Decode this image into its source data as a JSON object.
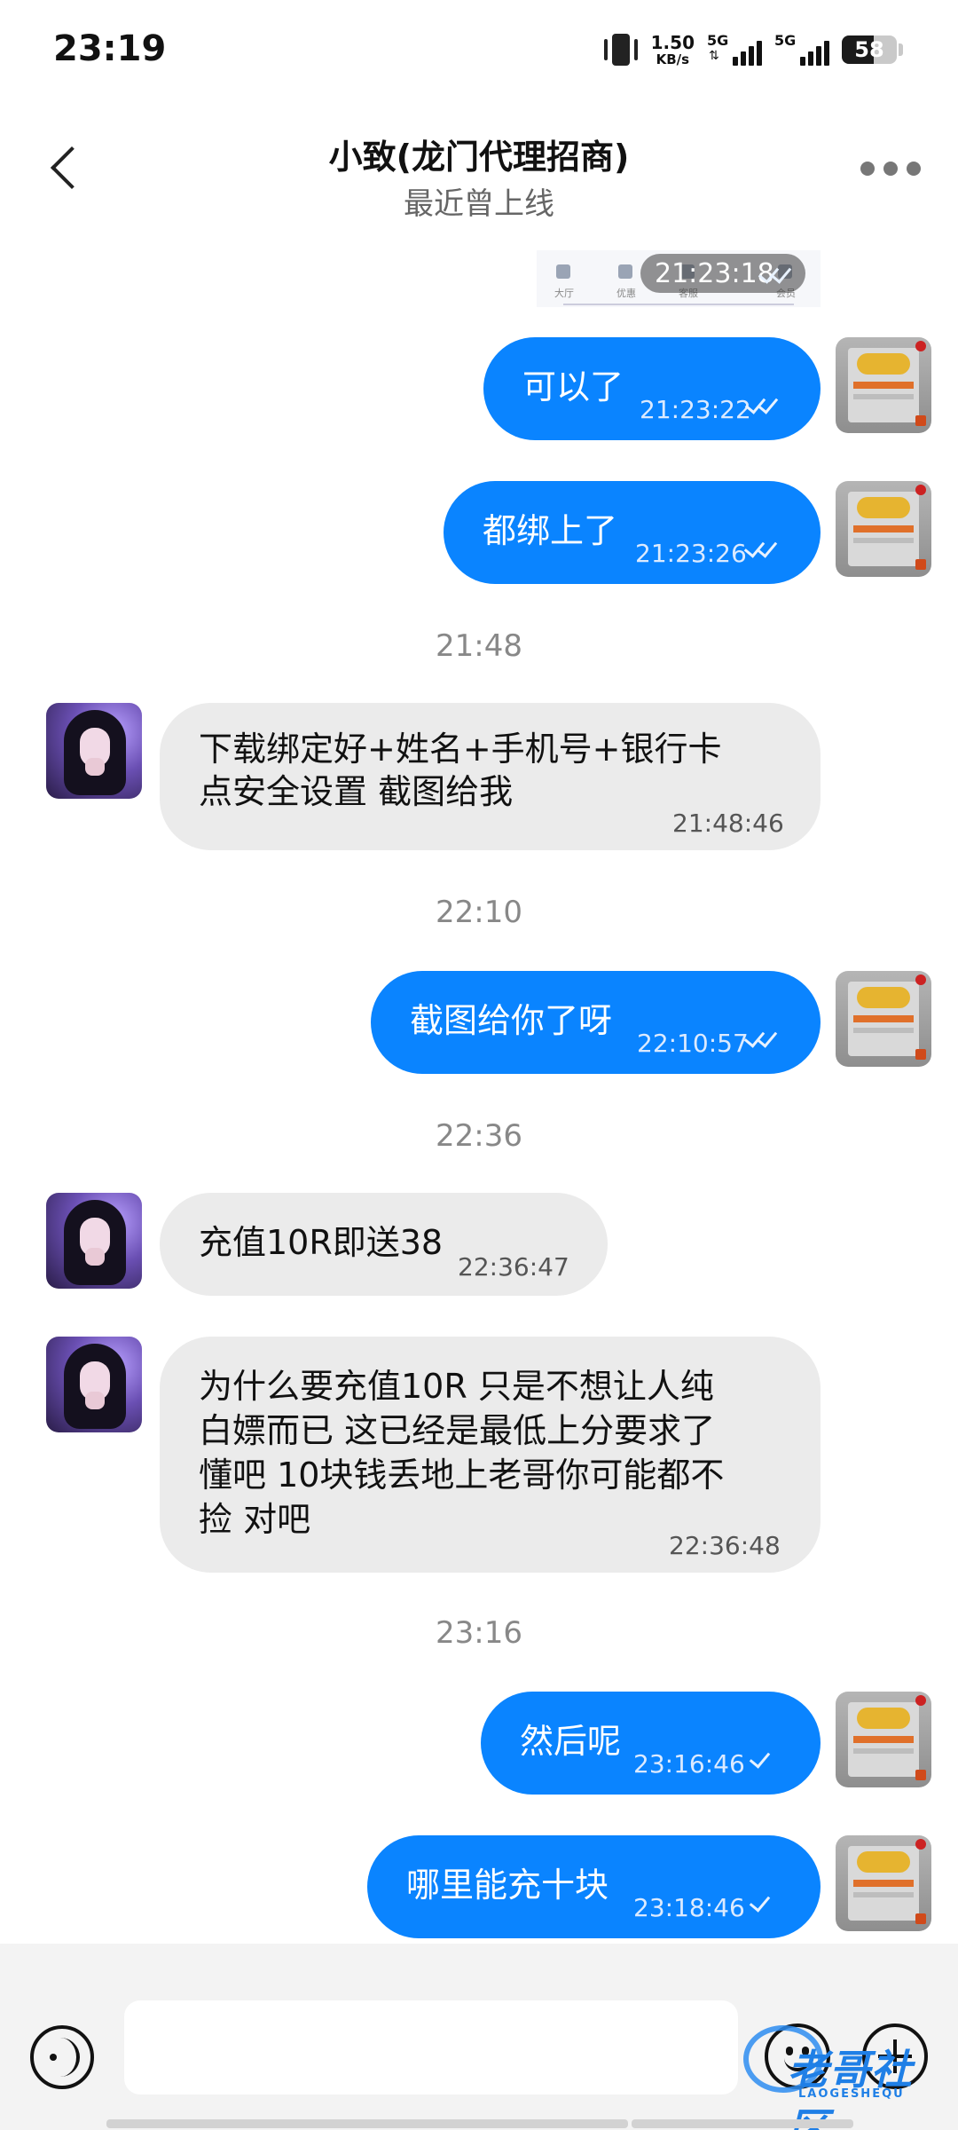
{
  "status_bar": {
    "time": "23:19",
    "net_speed_value": "1.50",
    "net_speed_unit": "KB/s",
    "sim1_label": "5G",
    "sim2_label": "5G",
    "battery_level": "58",
    "icons": [
      "vibrate-icon",
      "signal-icon",
      "signal-icon",
      "battery-icon"
    ]
  },
  "header": {
    "title": "小致(龙门代理招商)",
    "subtitle": "最近曾上线",
    "icons": [
      "back-arrow-icon",
      "more-icon"
    ]
  },
  "shared_image": {
    "time": "21:23:18",
    "tabs": [
      "大厅",
      "优惠",
      "客服",
      "会员"
    ]
  },
  "messages": [
    {
      "type": "out",
      "text": "可以了",
      "time": "21:23:22",
      "status": "read"
    },
    {
      "type": "out",
      "text": "都绑上了",
      "time": "21:23:26",
      "status": "read"
    },
    {
      "type": "separator",
      "text": "21:48"
    },
    {
      "type": "in",
      "lines": [
        "下载绑定好+姓名+手机号+银行卡",
        "点安全设置 截图给我"
      ],
      "time": "21:48:46"
    },
    {
      "type": "separator",
      "text": "22:10"
    },
    {
      "type": "out",
      "text": "截图给你了呀",
      "time": "22:10:57",
      "status": "read"
    },
    {
      "type": "separator",
      "text": "22:36"
    },
    {
      "type": "in",
      "lines": [
        "充值10R即送38"
      ],
      "time": "22:36:47"
    },
    {
      "type": "in",
      "lines": [
        "为什么要充值10R  只是不想让人纯",
        "白嫖而已 这已经是最低上分要求了",
        "懂吧  10块钱丢地上老哥你可能都不",
        "捡 对吧"
      ],
      "time": "22:36:48"
    },
    {
      "type": "separator",
      "text": "23:16"
    },
    {
      "type": "out",
      "text": "然后呢",
      "time": "23:16:46",
      "status": "sent"
    },
    {
      "type": "out",
      "text": "哪里能充十块",
      "time": "23:18:46",
      "status": "sent"
    }
  ],
  "input_bar": {
    "placeholder": "",
    "value": "",
    "icons": [
      "voice-icon",
      "emoji-icon",
      "plus-icon"
    ]
  },
  "watermark": {
    "brand": "老哥社区",
    "brand_latin": "LAOGESHEQU"
  },
  "colors": {
    "outgoing_bubble": "#0a84ff",
    "incoming_bubble": "#ebebeb",
    "background": "#ffffff",
    "input_bar": "#f3f3f3"
  }
}
